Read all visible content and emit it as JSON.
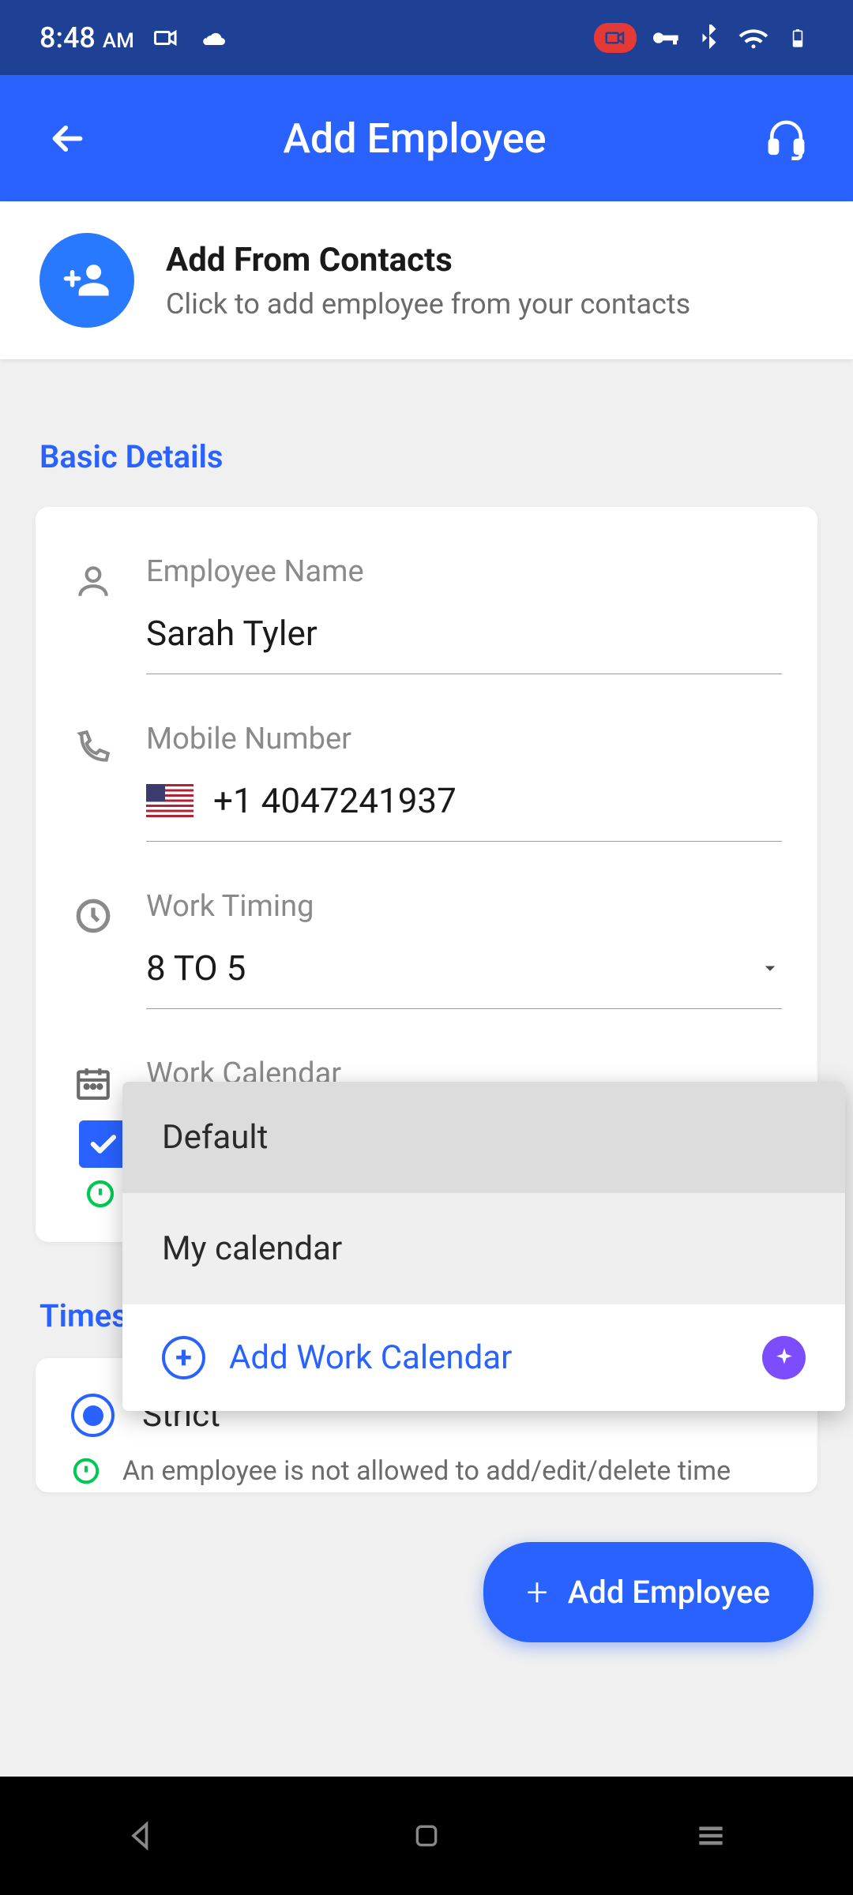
{
  "status": {
    "time": "8:48",
    "ampm": "AM"
  },
  "header": {
    "title": "Add Employee"
  },
  "contacts": {
    "title": "Add From Contacts",
    "subtitle": "Click to add employee from your contacts"
  },
  "sections": {
    "basic": "Basic Details",
    "timesheet": "Timesheet Restriction"
  },
  "fields": {
    "name_label": "Employee Name",
    "name_value": "Sarah Tyler",
    "mobile_label": "Mobile Number",
    "mobile_value": "+1 4047241937",
    "timing_label": "Work Timing",
    "timing_value": "8 TO 5",
    "calendar_label": "Work Calendar"
  },
  "dropdown": {
    "options": [
      "Default",
      "My calendar"
    ],
    "opt0": "Default",
    "opt1": "My calendar",
    "add_label": "Add Work Calendar"
  },
  "timesheet": {
    "option": "Strict",
    "description": "An employee is not allowed to add/edit/delete time entries"
  },
  "fab": {
    "label": "Add Employee"
  }
}
